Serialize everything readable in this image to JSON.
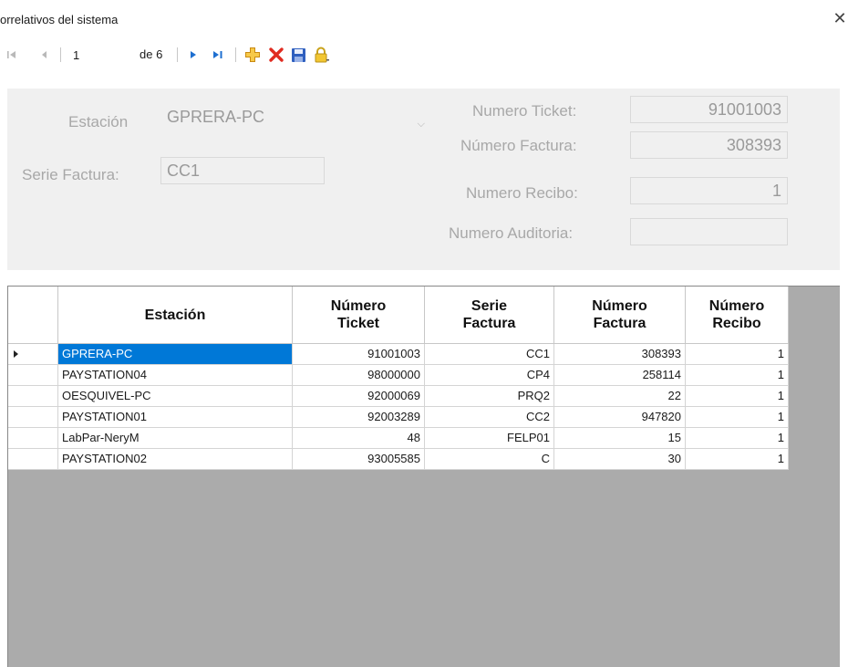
{
  "window": {
    "title": "orrelativos del sistema"
  },
  "toolbar": {
    "position_value": "1",
    "count_label": "de 6"
  },
  "detail": {
    "estacion_label": "Estación",
    "estacion_value": "GPRERA-PC",
    "serie_label": "Serie Factura:",
    "serie_value": "CC1",
    "ticket_label": "Numero Ticket:",
    "ticket_value": "91001003",
    "factura_label": "Número Factura:",
    "factura_value": "308393",
    "recibo_label": "Numero Recibo:",
    "recibo_value": "1",
    "auditoria_label": "Numero Auditoria:",
    "auditoria_value": ""
  },
  "grid": {
    "headers": {
      "estacion": "Estación",
      "ticket_1": "Número",
      "ticket_2": "Ticket",
      "serie_1": "Serie",
      "serie_2": "Factura",
      "factura_1": "Número",
      "factura_2": "Factura",
      "recibo_1": "Número",
      "recibo_2": "Recibo"
    },
    "rows": [
      [
        "GPRERA-PC",
        "91001003",
        "CC1",
        "308393",
        "1"
      ],
      [
        "PAYSTATION04",
        "98000000",
        "CP4",
        "258114",
        "1"
      ],
      [
        "OESQUIVEL-PC",
        "92000069",
        "PRQ2",
        "22",
        "1"
      ],
      [
        "PAYSTATION01",
        "92003289",
        "CC2",
        "947820",
        "1"
      ],
      [
        "LabPar-NeryM",
        "48",
        "FELP01",
        "15",
        "1"
      ],
      [
        "PAYSTATION02",
        "93005585",
        "C",
        "30",
        "1"
      ]
    ]
  },
  "colors": {
    "selection": "#0078d7",
    "grid_background": "#ababab",
    "panel_background": "#f0f0f0",
    "nav_blue": "#1e6fd0",
    "delete_red": "#e02b20"
  }
}
